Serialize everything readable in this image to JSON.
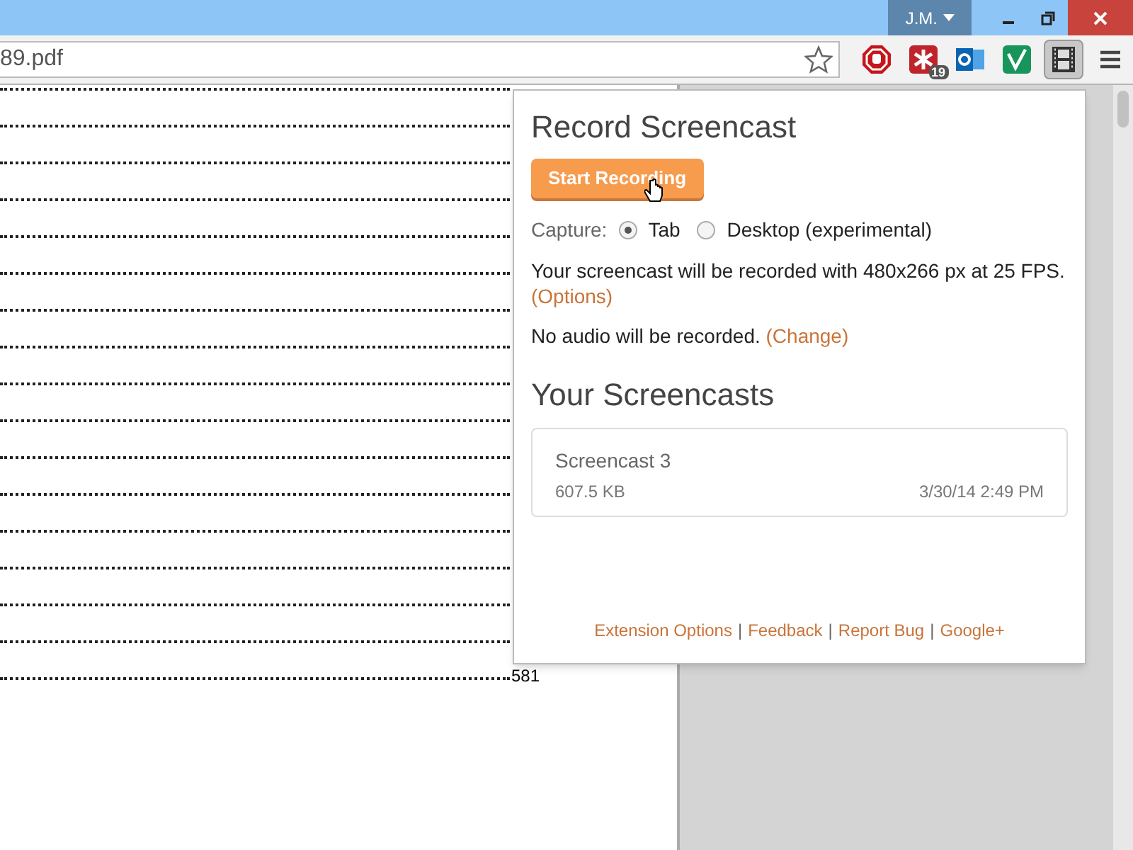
{
  "window": {
    "user": "J.M."
  },
  "address_bar": {
    "url": "89.pdf"
  },
  "extensions": [
    {
      "kind": "stop"
    },
    {
      "kind": "puzzle",
      "badge": "19"
    },
    {
      "kind": "mail"
    },
    {
      "kind": "check"
    },
    {
      "kind": "film",
      "selected": true
    }
  ],
  "document": {
    "page_number": "581"
  },
  "popup": {
    "title": "Record Screencast",
    "start_button": "Start Recording",
    "capture_label": "Capture:",
    "capture_options": [
      {
        "label": "Tab",
        "selected": true
      },
      {
        "label": "Desktop (experimental)",
        "selected": false
      }
    ],
    "video_info": "Your screencast will be recorded with 480x266 px at 25 FPS.",
    "options_link": "(Options)",
    "audio_info": "No audio will be recorded.",
    "change_link": "(Change)",
    "screencasts_title": "Your Screencasts",
    "screencasts": [
      {
        "name": "Screencast 3",
        "size": "607.5 KB",
        "date": "3/30/14 2:49 PM"
      }
    ],
    "footer_links": [
      "Extension Options",
      "Feedback",
      "Report Bug",
      "Google+"
    ],
    "footer_separators": [
      "|",
      "|",
      "|"
    ]
  }
}
